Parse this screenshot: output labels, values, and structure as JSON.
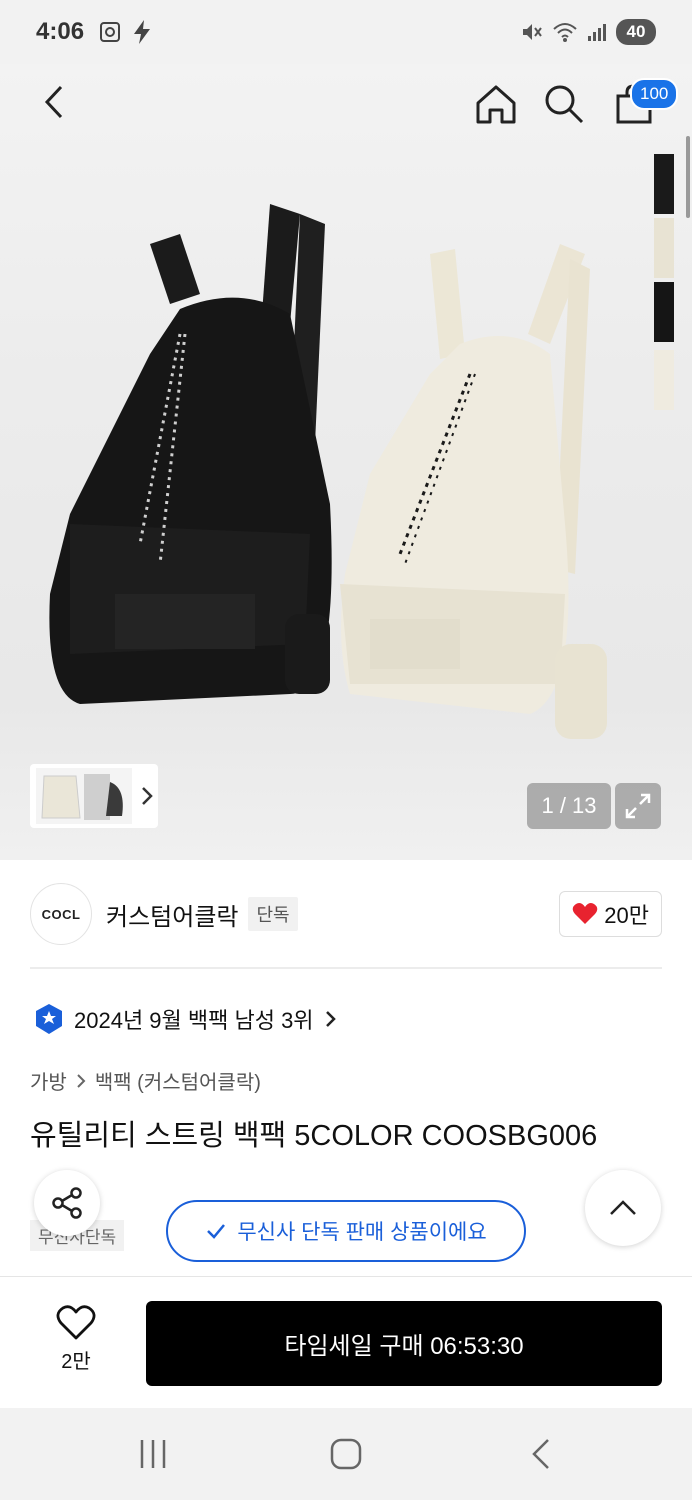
{
  "status_bar": {
    "time": "4:06",
    "battery": "40",
    "icons": [
      "screenshot-icon",
      "charging-icon",
      "mute-icon",
      "wifi-icon",
      "signal-icon"
    ]
  },
  "header": {
    "back_icon": "back-arrow-icon",
    "home_icon": "home-icon",
    "search_icon": "search-icon",
    "cart_icon": "shopping-bag-icon",
    "cart_badge": "100"
  },
  "gallery": {
    "counter": "1 / 13",
    "color_swatches": [
      "#1a1a1a",
      "#e8e3d3",
      "#151515",
      "#efebe0"
    ]
  },
  "brand": {
    "logo_text": "COCL",
    "name": "커스텀어클락",
    "tag": "단독",
    "likes": "20만"
  },
  "ranking": {
    "text": "2024년 9월 백팩 남성 3위"
  },
  "breadcrumb": {
    "level1": "가방",
    "level2": "백팩 (커스텀어클락)"
  },
  "product": {
    "title": "유틸리티 스트링 백팩 5COLOR COOSBG006",
    "small_tag": "무신사단독",
    "notice": "무신사 단독 판매 상품이에요"
  },
  "bottom": {
    "like_count": "2만",
    "buy_label": "타임세일 구매 06:53:30"
  },
  "colors": {
    "accent": "#1a5fd9",
    "badge": "#1a73e8",
    "heart": "#e8232f"
  }
}
